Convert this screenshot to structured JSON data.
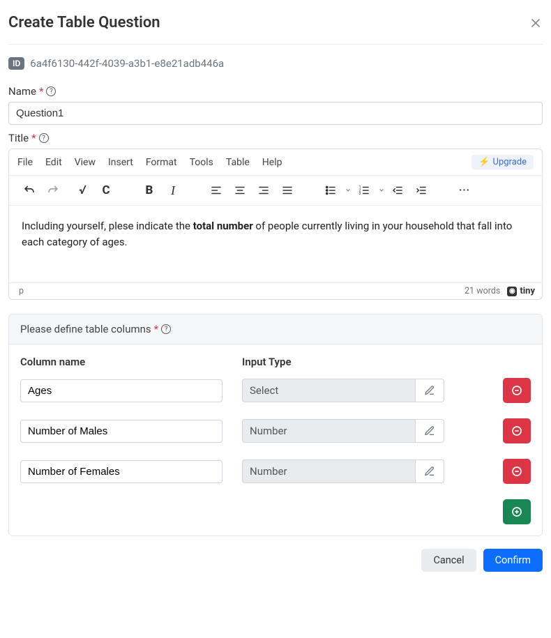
{
  "header": {
    "title": "Create Table Question"
  },
  "id": {
    "badge": "ID",
    "value": "6a4f6130-442f-4039-a3b1-e8e21adb446a"
  },
  "name": {
    "label": "Name",
    "value": "Question1"
  },
  "title": {
    "label": "Title",
    "menubar": [
      "File",
      "Edit",
      "View",
      "Insert",
      "Format",
      "Tools",
      "Table",
      "Help"
    ],
    "upgrade": "Upgrade",
    "content_prefix": "Including yourself, plese indicate the ",
    "content_bold": "total number",
    "content_suffix": " of people currently living in your household that fall into each category of ages.",
    "status_path": "p",
    "status_words": "21 words",
    "logo_text": "tiny"
  },
  "columns": {
    "section_label": "Please define table columns",
    "header_name": "Column name",
    "header_type": "Input Type",
    "rows": [
      {
        "name": "Ages",
        "type": "Select"
      },
      {
        "name": "Number of Males",
        "type": "Number"
      },
      {
        "name": "Number of Females",
        "type": "Number"
      }
    ]
  },
  "footer": {
    "cancel": "Cancel",
    "confirm": "Confirm"
  }
}
